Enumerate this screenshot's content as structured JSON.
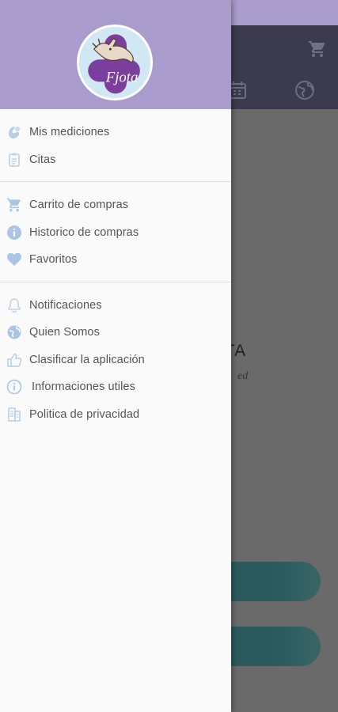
{
  "colors": {
    "header": "#a99bcb",
    "drawer_bg": "#fafafa",
    "icon": "#aac6e4",
    "icon_dark": "#c5d6e8",
    "label": "#555555",
    "backdrop": "#6a6a6a",
    "toolbar": "#3b3a4e",
    "button": "#2e5b5e"
  },
  "drawer": {
    "logo": {
      "text": "Fjota",
      "icon": "fjota-logo-icon"
    },
    "groups": [
      {
        "items": [
          {
            "label": "Mis mediciones",
            "icon": "measurement-icon"
          },
          {
            "label": "Citas",
            "icon": "clipboard-icon"
          }
        ]
      },
      {
        "items": [
          {
            "label": "Carrito de compras",
            "icon": "cart-icon"
          },
          {
            "label": "Historico de compras",
            "icon": "info-filled-icon"
          },
          {
            "label": "Favoritos",
            "icon": "heart-icon"
          }
        ]
      },
      {
        "items": [
          {
            "label": "Notificaciones",
            "icon": "bell-icon"
          },
          {
            "label": "Quien Somos",
            "icon": "globe-icon"
          },
          {
            "label": "Clasificar la aplicación",
            "icon": "thumbs-up-icon"
          },
          {
            "label": "Informaciones utiles",
            "icon": "info-outline-icon"
          },
          {
            "label": "Politica de privacidad",
            "icon": "document-icon"
          }
        ]
      }
    ]
  },
  "background_app": {
    "title_fragment": "JOTA",
    "subtitle_fragment": "ed"
  }
}
